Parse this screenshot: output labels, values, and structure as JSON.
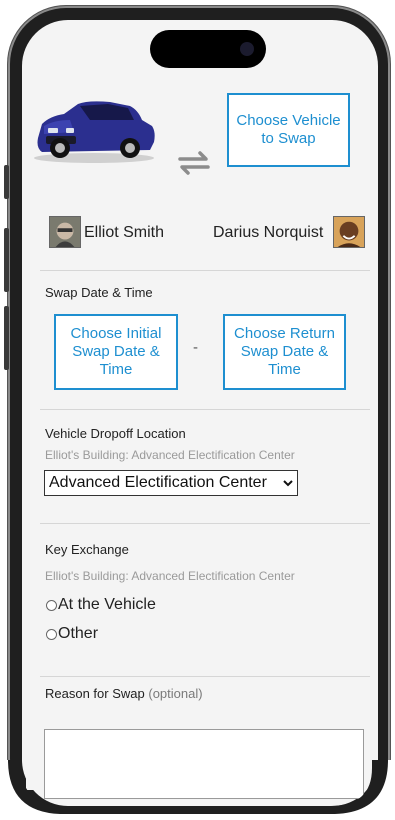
{
  "vehicle": {
    "choose_label": "Choose Vehicle to Swap"
  },
  "participants": {
    "left_name": "Elliot Smith",
    "right_name": "Darius Norquist"
  },
  "swap_datetime": {
    "title": "Swap Date & Time",
    "initial_label": "Choose Initial Swap Date & Time",
    "separator": "-",
    "return_label": "Choose Return Swap Date & Time"
  },
  "dropoff": {
    "title": "Vehicle Dropoff Location",
    "hint": "Elliot's Building: Advanced Electification Center",
    "selected": "Advanced Electification Center"
  },
  "key_exchange": {
    "title": "Key Exchange",
    "hint": "Elliot's Building: Advanced Electification Center",
    "options": [
      "At the Vehicle",
      "Other"
    ]
  },
  "reason": {
    "title": "Reason for Swap",
    "optional": "(optional)"
  },
  "colors": {
    "accent": "#1e8fd0",
    "car_body": "#2b2f8f"
  }
}
